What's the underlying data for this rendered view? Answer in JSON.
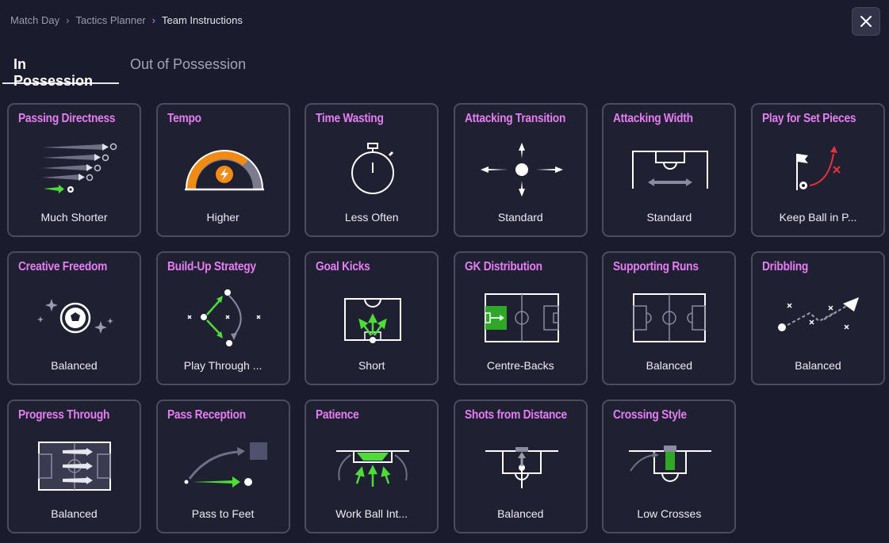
{
  "breadcrumb": {
    "items": [
      "Match Day",
      "Tactics Planner",
      "Team Instructions"
    ]
  },
  "tabs": [
    {
      "label": "In Possession",
      "active": true
    },
    {
      "label": "Out of Possession",
      "active": false
    }
  ],
  "colors": {
    "accent": "#e57ef2",
    "green": "#4fdc3a",
    "orange": "#f28a16",
    "red": "#e8323c",
    "card_border": "#4a4c60",
    "background": "#1a1b2c"
  },
  "cards": [
    {
      "title": "Passing Directness",
      "value": "Much Shorter",
      "icon": "passing-directness-icon"
    },
    {
      "title": "Tempo",
      "value": "Higher",
      "icon": "tempo-gauge-icon"
    },
    {
      "title": "Time Wasting",
      "value": "Less Often",
      "icon": "stopwatch-icon"
    },
    {
      "title": "Attacking Transition",
      "value": "Standard",
      "icon": "attacking-transition-icon"
    },
    {
      "title": "Attacking Width",
      "value": "Standard",
      "icon": "attacking-width-icon"
    },
    {
      "title": "Play for Set Pieces",
      "value": "Keep Ball in P...",
      "icon": "set-pieces-icon"
    },
    {
      "title": "Creative Freedom",
      "value": "Balanced",
      "icon": "creative-freedom-icon"
    },
    {
      "title": "Build-Up Strategy",
      "value": "Play Through ...",
      "icon": "build-up-strategy-icon"
    },
    {
      "title": "Goal Kicks",
      "value": "Short",
      "icon": "goal-kicks-icon"
    },
    {
      "title": "GK Distribution",
      "value": "Centre-Backs",
      "icon": "gk-distribution-icon"
    },
    {
      "title": "Supporting Runs",
      "value": "Balanced",
      "icon": "supporting-runs-icon"
    },
    {
      "title": "Dribbling",
      "value": "Balanced",
      "icon": "dribbling-icon"
    },
    {
      "title": "Progress Through",
      "value": "Balanced",
      "icon": "progress-through-icon"
    },
    {
      "title": "Pass Reception",
      "value": "Pass to Feet",
      "icon": "pass-reception-icon"
    },
    {
      "title": "Patience",
      "value": "Work Ball Int...",
      "icon": "patience-icon"
    },
    {
      "title": "Shots from Distance",
      "value": "Balanced",
      "icon": "shots-from-distance-icon"
    },
    {
      "title": "Crossing Style",
      "value": "Low Crosses",
      "icon": "crossing-style-icon"
    }
  ]
}
